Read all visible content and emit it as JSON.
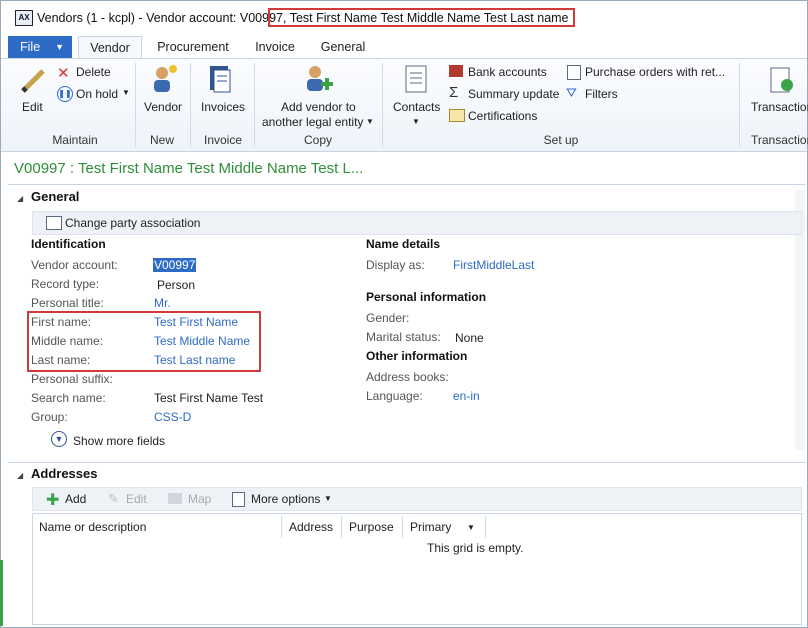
{
  "window": {
    "title": "Vendors (1 - kcpl) - Vendor account: V00997,",
    "title_highlight": "Test First Name Test Middle Name Test Last name"
  },
  "tabs": {
    "file": "File",
    "items": [
      "Vendor",
      "Procurement",
      "Invoice",
      "General"
    ],
    "active": "Vendor"
  },
  "ribbon": {
    "maintain": {
      "edit": "Edit",
      "delete": "Delete",
      "on_hold": "On hold",
      "label": "Maintain"
    },
    "new": {
      "vendor": "Vendor",
      "label": "New"
    },
    "invoice": {
      "invoices": "Invoices",
      "label": "Invoice"
    },
    "copy": {
      "add_vendor_line1": "Add vendor to",
      "add_vendor_line2": "another legal entity",
      "label": "Copy"
    },
    "setup": {
      "contacts": "Contacts",
      "bank_accounts": "Bank accounts",
      "summary_update": "Summary update",
      "certifications": "Certifications",
      "purchase_orders": "Purchase orders with ret...",
      "filters": "Filters",
      "label": "Set up"
    },
    "transactions": {
      "transactions": "Transaction",
      "label": "Transaction"
    }
  },
  "record": {
    "title": "V00997 : Test First Name Test Middle Name Test L..."
  },
  "general": {
    "header": "General",
    "change_party": "Change party association",
    "identification": {
      "header": "Identification",
      "vendor_account_label": "Vendor account:",
      "vendor_account_value": "V00997",
      "record_type_label": "Record type:",
      "record_type_value": "Person",
      "personal_title_label": "Personal title:",
      "personal_title_value": "Mr.",
      "first_name_label": "First name:",
      "first_name_value": "Test First Name",
      "middle_name_label": "Middle name:",
      "middle_name_value": "Test Middle Name",
      "last_name_label": "Last name:",
      "last_name_value": "Test Last name",
      "personal_suffix_label": "Personal suffix:",
      "search_name_label": "Search name:",
      "search_name_value": "Test First Name Test",
      "group_label": "Group:",
      "group_value": "CSS-D",
      "show_more": "Show more fields"
    },
    "name_details": {
      "header": "Name details",
      "display_as_label": "Display as:",
      "display_as_value": "FirstMiddleLast"
    },
    "personal_info": {
      "header": "Personal information",
      "gender_label": "Gender:",
      "marital_label": "Marital status:",
      "marital_value": "None"
    },
    "other_info": {
      "header": "Other information",
      "address_books_label": "Address books:",
      "language_label": "Language:",
      "language_value": "en-in"
    }
  },
  "addresses": {
    "header": "Addresses",
    "toolbar": {
      "add": "Add",
      "edit": "Edit",
      "map": "Map",
      "more": "More options"
    },
    "columns": [
      "Name or description",
      "Address",
      "Purpose",
      "Primary"
    ],
    "empty": "This grid is empty."
  },
  "colors": {
    "accent": "#2e6bc6",
    "highlight_border": "#d23a3a",
    "record_title": "#2f8f3a"
  }
}
